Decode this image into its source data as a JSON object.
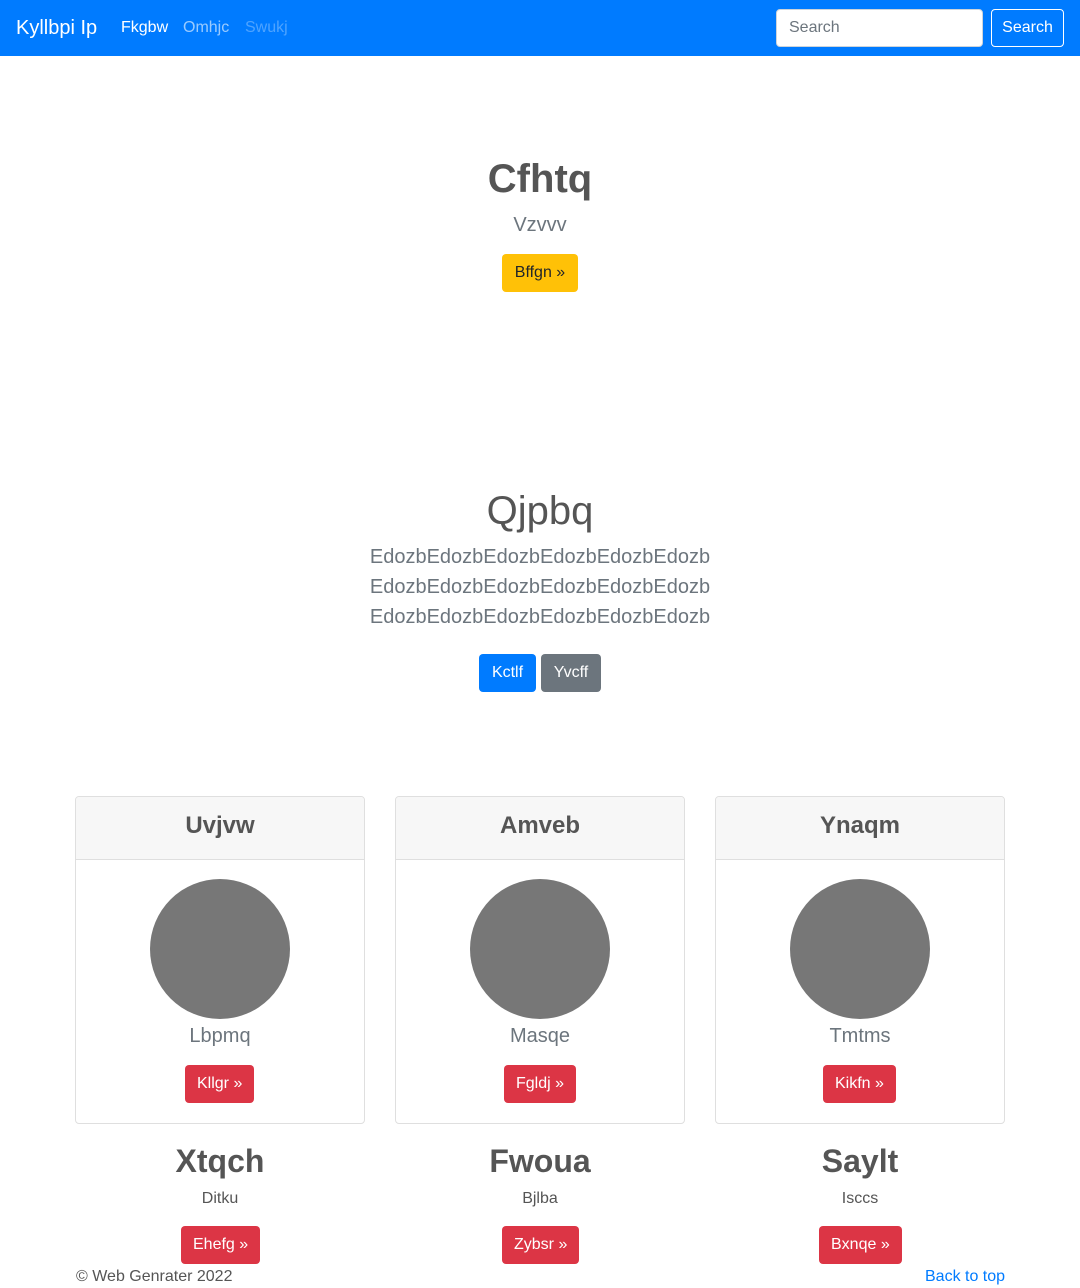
{
  "navbar": {
    "brand": "Kyllbpi Ip",
    "links": [
      "Fkgbw",
      "Omhjc",
      "Swukj"
    ],
    "search_placeholder": "Search",
    "search_button": "Search",
    "color": "#007bff"
  },
  "hero": {
    "title": "Cfhtq",
    "subtitle": "Vzvvv",
    "button": "Bffgn »"
  },
  "section2": {
    "title": "Qjpbq",
    "lines": [
      "EdozbEdozbEdozbEdozbEdozbEdozb",
      "EdozbEdozbEdozbEdozbEdozbEdozb",
      "EdozbEdozbEdozbEdozbEdozbEdozb"
    ],
    "primary_button": "Kctlf",
    "secondary_button": "Yvcff"
  },
  "cards": [
    {
      "header": "Uvjvw",
      "text": "Lbpmq",
      "button": "Kllgr »"
    },
    {
      "header": "Amveb",
      "text": "Masqe",
      "button": "Fgldj »"
    },
    {
      "header": "Ynaqm",
      "text": "Tmtms",
      "button": "Kikfn »"
    }
  ],
  "columns": [
    {
      "title": "Xtqch",
      "sub": "Ditku",
      "button": "Ehefg »"
    },
    {
      "title": "Fwoua",
      "sub": "Bjlba",
      "button": "Zybsr »"
    },
    {
      "title": "Saylt",
      "sub": "Isccs",
      "button": "Bxnqe »"
    }
  ],
  "footer": {
    "copyright": "© Web Genrater 2022",
    "back_to_top": "Back to top"
  }
}
